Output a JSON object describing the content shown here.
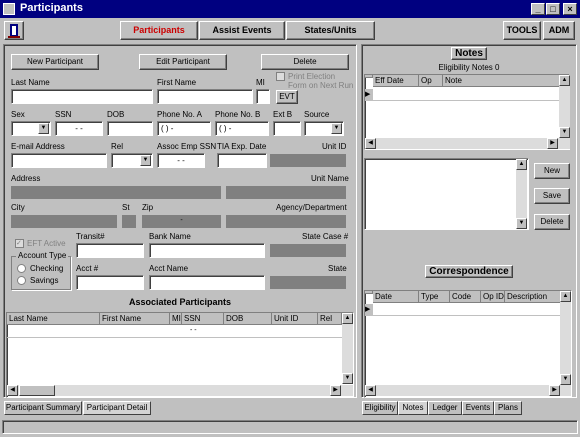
{
  "window": {
    "title": "Participants"
  },
  "toolbar": {
    "tabs": [
      {
        "label": "Participants",
        "active": true
      },
      {
        "label": "Assist Events"
      },
      {
        "label": "States/Units"
      }
    ],
    "tools_label": "TOOLS",
    "adm_label": "ADM",
    "active_color": "#cc0000"
  },
  "actions": {
    "new_participant": "New Participant",
    "edit_participant": "Edit Participant",
    "delete": "Delete"
  },
  "form": {
    "last_name": "Last Name",
    "first_name": "First Name",
    "mi": "MI",
    "print_election": "Print Election Form on Next Run",
    "evt": "EVT",
    "sex": "Sex",
    "ssn": "SSN",
    "ssn_value": "-   -",
    "dob": "DOB",
    "phone_a": "Phone No. A",
    "phone_b": "Phone No. B",
    "phone_placeholder": "(   )   -",
    "ext_b": "Ext B",
    "source": "Source",
    "email": "E-mail Address",
    "rel": "Rel",
    "assoc_emp_ssn": "Assoc Emp SSN",
    "assoc_value": "-   -",
    "tia_exp_date": "TIA Exp. Date",
    "unit_id": "Unit ID",
    "address": "Address",
    "unit_name": "Unit Name",
    "city": "City",
    "st": "St",
    "zip": "Zip",
    "zip_value": "-",
    "agency": "Agency/Department",
    "eft_active": "EFT Active",
    "transit": "Transit#",
    "bank_name": "Bank Name",
    "state_case": "State Case #",
    "account_type": "Account Type",
    "checking": "Checking",
    "savings": "Savings",
    "acct_num": "Acct #",
    "acct_name": "Acct Name",
    "state": "State"
  },
  "associated": {
    "title": "Associated Participants",
    "columns": [
      "Last Name",
      "First Name",
      "MI",
      "SSN",
      "DOB",
      "Unit ID",
      "Rel"
    ],
    "row_ssn": "-  -"
  },
  "left_tabs": [
    "Participant Summary",
    "Participant Detail"
  ],
  "notes": {
    "title": "Notes",
    "subtitle": "Eligibility Notes 0",
    "columns": [
      "Eff Date",
      "Op",
      "Note"
    ],
    "buttons": {
      "new": "New",
      "save": "Save",
      "delete": "Delete"
    }
  },
  "correspondence": {
    "title": "Correspondence",
    "columns": [
      "Date",
      "Type",
      "Code",
      "Op ID",
      "Description"
    ]
  },
  "right_tabs": [
    "Eligibility",
    "Notes",
    "Ledger",
    "Events",
    "Plans"
  ]
}
